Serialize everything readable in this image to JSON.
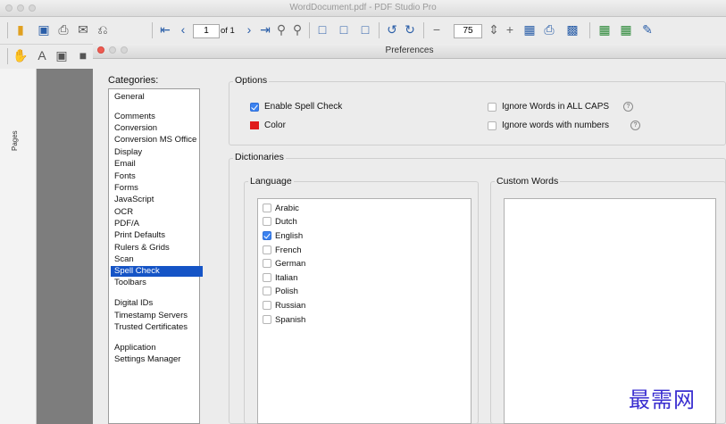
{
  "app": {
    "window_title": "WordDocument.pdf - PDF Studio Pro",
    "page_input": "1",
    "page_total": "of 1",
    "zoom_value": "75",
    "pages_panel_label": "Pages"
  },
  "dialog": {
    "title": "Preferences",
    "categories_label": "Categories:",
    "categories": [
      "General",
      "Comments",
      "Conversion",
      "Conversion MS Office",
      "Display",
      "Email",
      "Fonts",
      "Forms",
      "JavaScript",
      "OCR",
      "PDF/A",
      "Print Defaults",
      "Rulers & Grids",
      "Scan",
      "Spell Check",
      "Toolbars",
      "Digital IDs",
      "Timestamp Servers",
      "Trusted Certificates",
      "Application",
      "Settings Manager"
    ],
    "selected_category": "Spell Check",
    "options": {
      "legend": "Options",
      "enable_spell_check": {
        "label": "Enable Spell Check",
        "checked": true
      },
      "color": {
        "label": "Color",
        "value": "#e01b1b"
      },
      "ignore_all_caps": {
        "label": "Ignore Words in ALL CAPS",
        "checked": false
      },
      "ignore_with_numbers": {
        "label": "Ignore words with numbers",
        "checked": false
      }
    },
    "dictionaries": {
      "legend": "Dictionaries",
      "language_legend": "Language",
      "custom_words_legend": "Custom Words",
      "languages": [
        {
          "name": "Arabic",
          "checked": false
        },
        {
          "name": "Dutch",
          "checked": false
        },
        {
          "name": "English",
          "checked": true
        },
        {
          "name": "French",
          "checked": false
        },
        {
          "name": "German",
          "checked": false
        },
        {
          "name": "Italian",
          "checked": false
        },
        {
          "name": "Polish",
          "checked": false
        },
        {
          "name": "Russian",
          "checked": false
        },
        {
          "name": "Spanish",
          "checked": false
        }
      ]
    }
  },
  "watermark": "最需网",
  "colors": {
    "accent": "#1554c6",
    "checkbox_on": "#3b82f0"
  }
}
